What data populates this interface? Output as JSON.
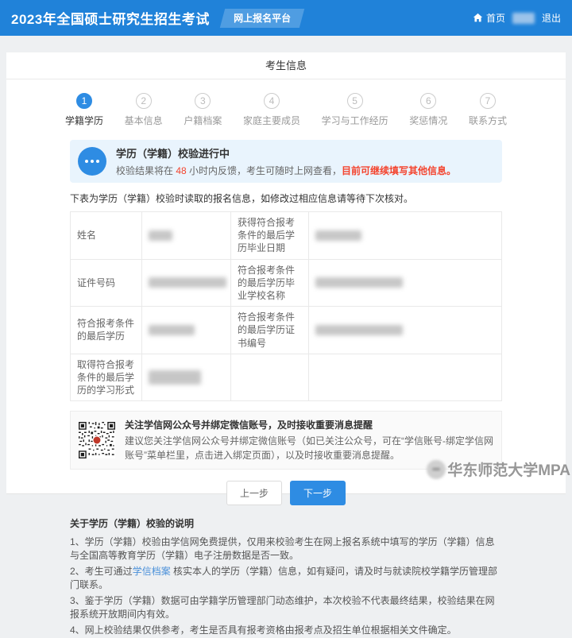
{
  "header": {
    "title": "2023年全国硕士研究生招生考试",
    "badge": "网上报名平台",
    "home_label": "首页",
    "logout_label": "退出"
  },
  "page": {
    "title": "考生信息"
  },
  "steps": [
    {
      "num": "1",
      "label": "学籍学历"
    },
    {
      "num": "2",
      "label": "基本信息"
    },
    {
      "num": "3",
      "label": "户籍档案"
    },
    {
      "num": "4",
      "label": "家庭主要成员"
    },
    {
      "num": "5",
      "label": "学习与工作经历"
    },
    {
      "num": "6",
      "label": "奖惩情况"
    },
    {
      "num": "7",
      "label": "联系方式"
    }
  ],
  "banner": {
    "title": "学历（学籍）校验进行中",
    "desc_prefix": "校验结果将在 ",
    "desc_hours": "48",
    "desc_mid": " 小时内反馈，考生可随时上网查看，",
    "desc_highlight": "目前可继续填写其他信息。"
  },
  "table_intro": "下表为学历（学籍）校验时读取的报名信息，如修改过相应信息请等待下次核对。",
  "table": {
    "rows": [
      {
        "label1": "姓名",
        "label2": "获得符合报考条件的最后学历毕业日期"
      },
      {
        "label1": "证件号码",
        "label2": "符合报考条件的最后学历毕业学校名称"
      },
      {
        "label1": "符合报考条件的最后学历",
        "label2": "符合报考条件的最后学历证书编号"
      },
      {
        "label1": "取得符合报考条件的最后学历的学习形式",
        "label2": ""
      }
    ]
  },
  "wechat_box": {
    "title": "关注学信网公众号并绑定微信账号，及时接收重要消息提醒",
    "body": "建议您关注学信网公众号并绑定微信账号（如已关注公众号，可在“学信账号-绑定学信网账号”菜单栏里，点击进入绑定页面），以及时接收重要消息提醒。"
  },
  "buttons": {
    "prev": "上一步",
    "next": "下一步"
  },
  "notes": {
    "title": "关于学历（学籍）校验的说明",
    "item1": "1、学历（学籍）校验由学信网免费提供，仅用来校验考生在网上报名系统中填写的学历（学籍）信息与全国高等教育学历（学籍）电子注册数据是否一致。",
    "item2_prefix": "2、考生可通过",
    "item2_link": "学信档案",
    "item2_suffix": " 核实本人的学历（学籍）信息，如有疑问，请及时与就读院校学籍学历管理部门联系。",
    "item3": "3、鉴于学历（学籍）数据可由学籍学历管理部门动态维护，本次校验不代表最终结果，校验结果在网报系统开放期间内有效。",
    "item4": "4、网上校验结果仅供参考，考生是否具有报考资格由报考点及招生单位根据相关文件确定。"
  },
  "watermark": "华东师范大学MPA",
  "colors": {
    "header_blue": "#2082d9",
    "accent_blue": "#2e8ce3",
    "banner_bg": "#e9f4fd",
    "alert_red": "#f4442e",
    "link_blue": "#4a90d9"
  }
}
